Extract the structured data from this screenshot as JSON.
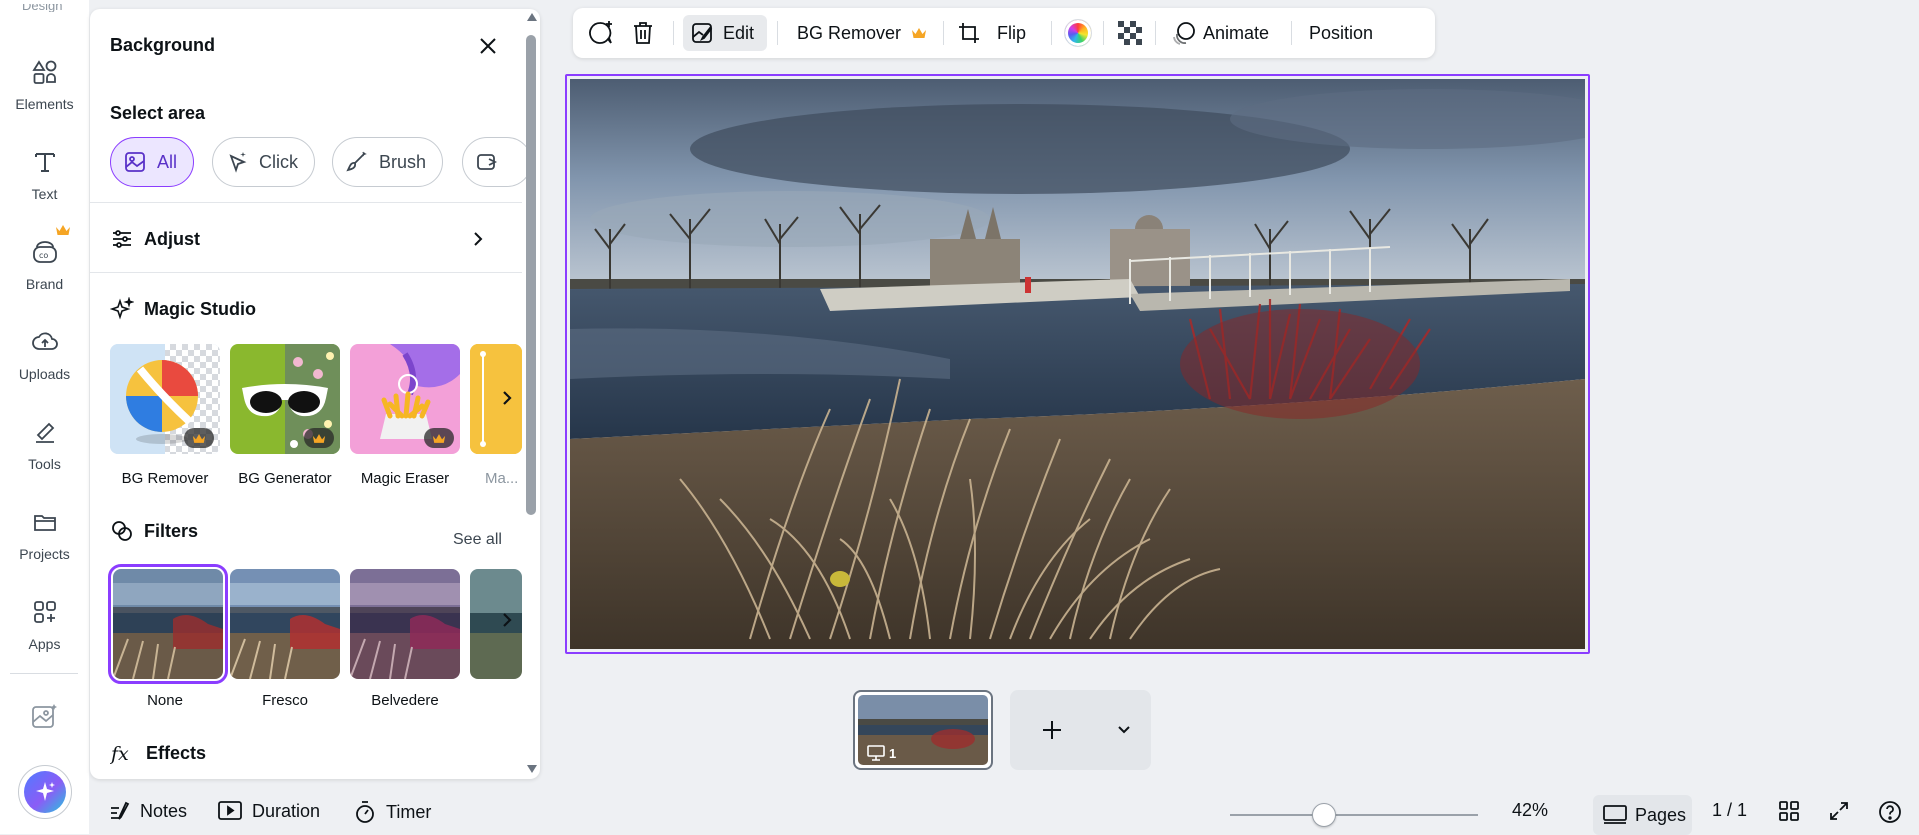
{
  "rail": {
    "cut_label": "Design",
    "items": [
      {
        "label": "Elements",
        "icon": "elements-icon"
      },
      {
        "label": "Text",
        "icon": "text-icon"
      },
      {
        "label": "Brand",
        "icon": "brand-icon"
      },
      {
        "label": "Uploads",
        "icon": "uploads-icon"
      },
      {
        "label": "Tools",
        "icon": "tools-icon"
      },
      {
        "label": "Projects",
        "icon": "projects-icon"
      },
      {
        "label": "Apps",
        "icon": "apps-icon"
      }
    ]
  },
  "panel": {
    "title": "Background",
    "select_area": {
      "label": "Select area",
      "chips": [
        "All",
        "Click",
        "Brush"
      ]
    },
    "adjust": "Adjust",
    "magic_studio": {
      "label": "Magic Studio",
      "tiles": [
        "BG Remover",
        "BG Generator",
        "Magic Eraser",
        "Ma..."
      ]
    },
    "filters": {
      "label": "Filters",
      "see_all": "See all",
      "tiles": [
        "None",
        "Fresco",
        "Belvedere"
      ]
    },
    "effects": "Effects"
  },
  "toolbar": {
    "edit": "Edit",
    "bg_remover": "BG Remover",
    "flip": "Flip",
    "animate": "Animate",
    "position": "Position"
  },
  "pages": {
    "thumb_number": "1"
  },
  "bottom": {
    "notes": "Notes",
    "duration": "Duration",
    "timer": "Timer",
    "zoom": "42%",
    "zoom_level": 0.42,
    "pages_label": "Pages",
    "page_count": "1 / 1"
  },
  "colors": {
    "accent": "#8b3dff",
    "crown": "#f5a524",
    "text": "#0d1216"
  }
}
